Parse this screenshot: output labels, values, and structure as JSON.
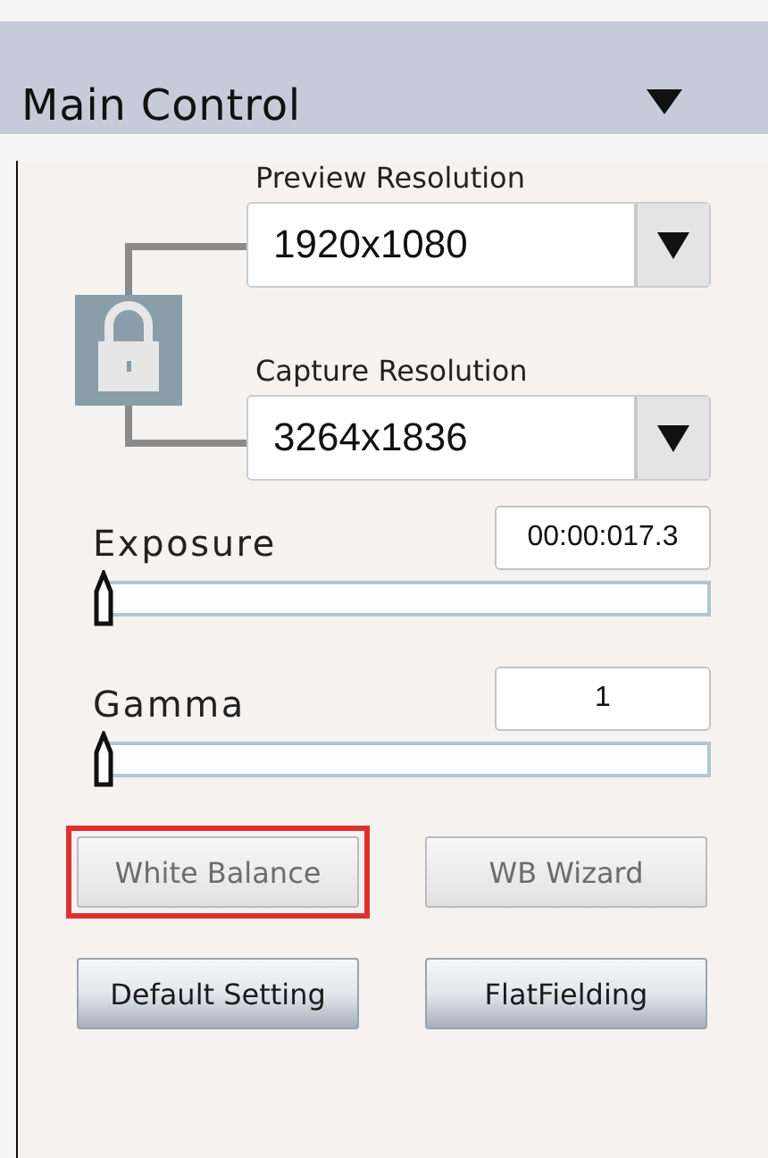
{
  "panel": {
    "title": "Main Control",
    "expanded": true
  },
  "resolution": {
    "linked": true,
    "selects": [
      {
        "label": "Preview Resolution",
        "value": "1920x1080"
      },
      {
        "label": "Capture Resolution",
        "value": "3264x1836"
      }
    ]
  },
  "sliders": [
    {
      "label": "Exposure",
      "value": "00:00:017.3",
      "level": 0
    },
    {
      "label": "Gamma",
      "value": "1",
      "level": 0
    }
  ],
  "buttons": [
    {
      "label": "White Balance",
      "disabled": true,
      "highlighted": true
    },
    {
      "label": "WB Wizard",
      "disabled": true,
      "highlighted": false
    },
    {
      "label": "Default Setting",
      "disabled": false,
      "highlighted": false
    },
    {
      "label": "FlatFielding",
      "disabled": false,
      "highlighted": false
    }
  ]
}
